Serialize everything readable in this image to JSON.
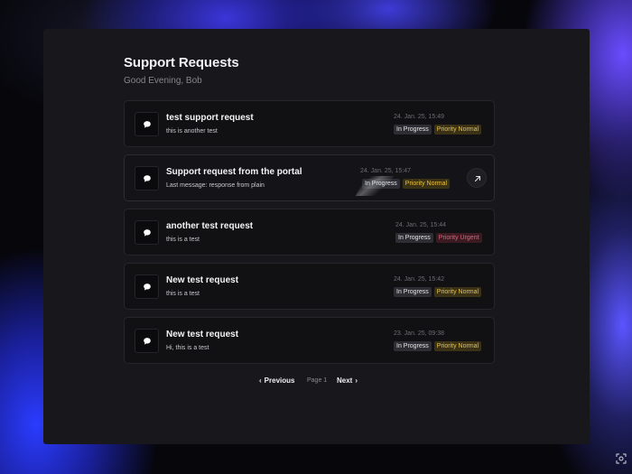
{
  "page": {
    "title": "Support Requests",
    "greeting": "Good Evening, Bob"
  },
  "requests": [
    {
      "title": "test support request",
      "subtitle": "this is another test",
      "date": "24. Jan. 25, 15:49",
      "status": "In Progress",
      "priority": "Priority Normal"
    },
    {
      "title": "Support request from the portal",
      "subtitle": "Last message: response from plain",
      "date": "24. Jan. 25, 15:47",
      "status": "In Progress",
      "priority": "Priority Normal"
    },
    {
      "title": "another test request",
      "subtitle": "this is a test",
      "date": "24. Jan. 25, 15:44",
      "status": "In Progress",
      "priority": "Priority Urgent"
    },
    {
      "title": "New test request",
      "subtitle": "this is a test",
      "date": "24. Jan. 25, 15:42",
      "status": "In Progress",
      "priority": "Priority Normal"
    },
    {
      "title": "New test request",
      "subtitle": "Hi, this is a test",
      "date": "23. Jan. 25, 09:38",
      "status": "In Progress",
      "priority": "Priority Normal"
    }
  ],
  "pagination": {
    "previous": "Previous",
    "page": "Page 1",
    "next": "Next"
  },
  "icons": {
    "request": "chat-bubble-icon",
    "open": "arrow-up-right-icon",
    "prev": "chevron-left-icon",
    "next": "chevron-right-icon"
  },
  "colors": {
    "priority_normal": "#e8c243",
    "priority_urgent": "#e0607a",
    "panel": "#18171c"
  }
}
